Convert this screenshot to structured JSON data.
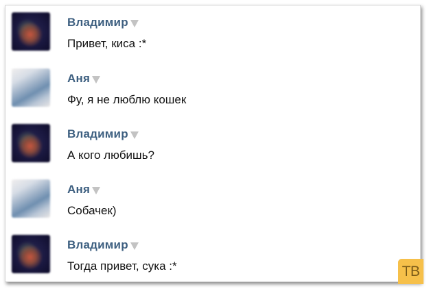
{
  "messages": [
    {
      "author": "Владимир",
      "text": "Привет, киса :*",
      "avatar": "vladimir-avatar"
    },
    {
      "author": "Аня",
      "text": "Фу, я не люблю кошек",
      "avatar": "anya-avatar"
    },
    {
      "author": "Владимир",
      "text": "А кого любишь?",
      "avatar": "vladimir-avatar"
    },
    {
      "author": "Аня",
      "text": "Собачек)",
      "avatar": "anya-avatar"
    },
    {
      "author": "Владимир",
      "text": "Тогда привет, сука :*",
      "avatar": "vladimir-avatar"
    }
  ],
  "watermark": {
    "text": "ТВ",
    "color": "#f6c04a"
  },
  "colors": {
    "author_name": "#3d5f80",
    "message_text": "#111111",
    "caret": "#c3c3c3"
  },
  "icons": {
    "author_menu": "caret-down-icon"
  }
}
